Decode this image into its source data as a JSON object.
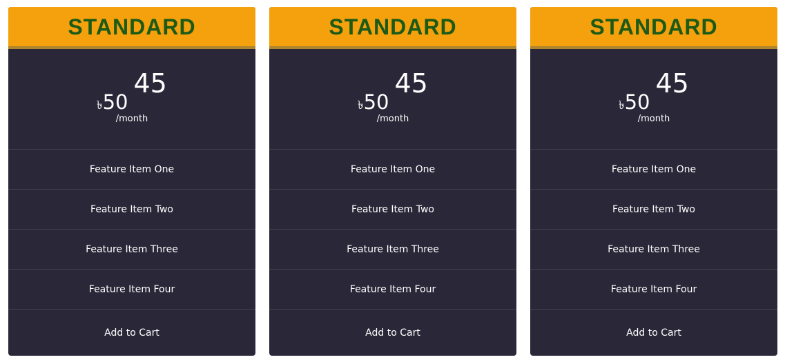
{
  "plans": [
    {
      "name": "STANDARD",
      "currency": "৳",
      "amount": "50",
      "cents": "45",
      "period": "/month",
      "features": [
        "Feature Item One",
        "Feature Item Two",
        "Feature Item Three",
        "Feature Item Four"
      ],
      "cta": "Add to Cart"
    },
    {
      "name": "STANDARD",
      "currency": "৳",
      "amount": "50",
      "cents": "45",
      "period": "/month",
      "features": [
        "Feature Item One",
        "Feature Item Two",
        "Feature Item Three",
        "Feature Item Four"
      ],
      "cta": "Add to Cart"
    },
    {
      "name": "STANDARD",
      "currency": "৳",
      "amount": "50",
      "cents": "45",
      "period": "/month",
      "features": [
        "Feature Item One",
        "Feature Item Two",
        "Feature Item Three",
        "Feature Item Four"
      ],
      "cta": "Add to Cart"
    }
  ],
  "colors": {
    "header_bg": "#f5a00d",
    "header_text": "#1c5a17",
    "card_bg": "#2a2838",
    "text": "#ffffff"
  }
}
